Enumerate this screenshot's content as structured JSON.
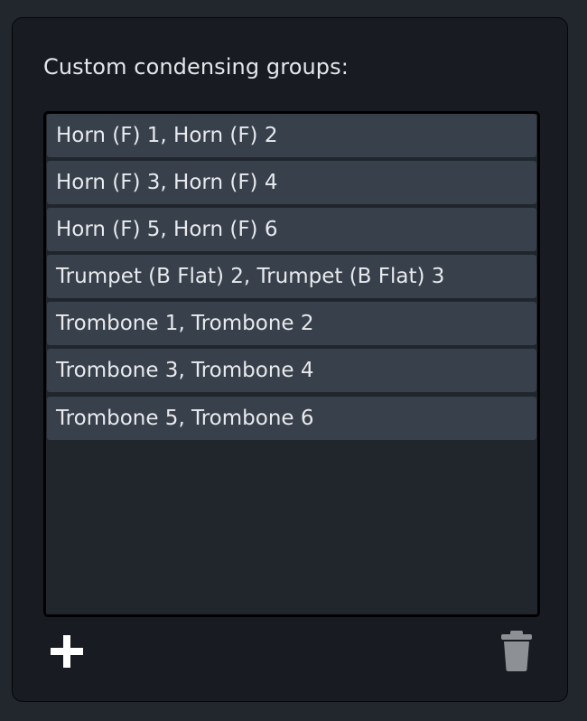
{
  "panel": {
    "label": "Custom condensing groups:"
  },
  "groups": [
    {
      "label": "Horn (F) 1, Horn (F) 2"
    },
    {
      "label": "Horn (F) 3, Horn (F) 4"
    },
    {
      "label": "Horn (F) 5, Horn (F) 6"
    },
    {
      "label": "Trumpet (B Flat) 2, Trumpet (B Flat) 3"
    },
    {
      "label": "Trombone 1, Trombone 2"
    },
    {
      "label": "Trombone 3, Trombone 4"
    },
    {
      "label": "Trombone 5, Trombone 6"
    }
  ],
  "actions": {
    "add_icon": "plus-icon",
    "delete_icon": "trash-icon"
  },
  "colors": {
    "background": "#22272e",
    "panel": "#181c22",
    "list": "#21262d",
    "item": "#38404b",
    "text": "#e3e6ea",
    "add_icon": "#ffffff",
    "delete_icon": "#8d9195"
  }
}
